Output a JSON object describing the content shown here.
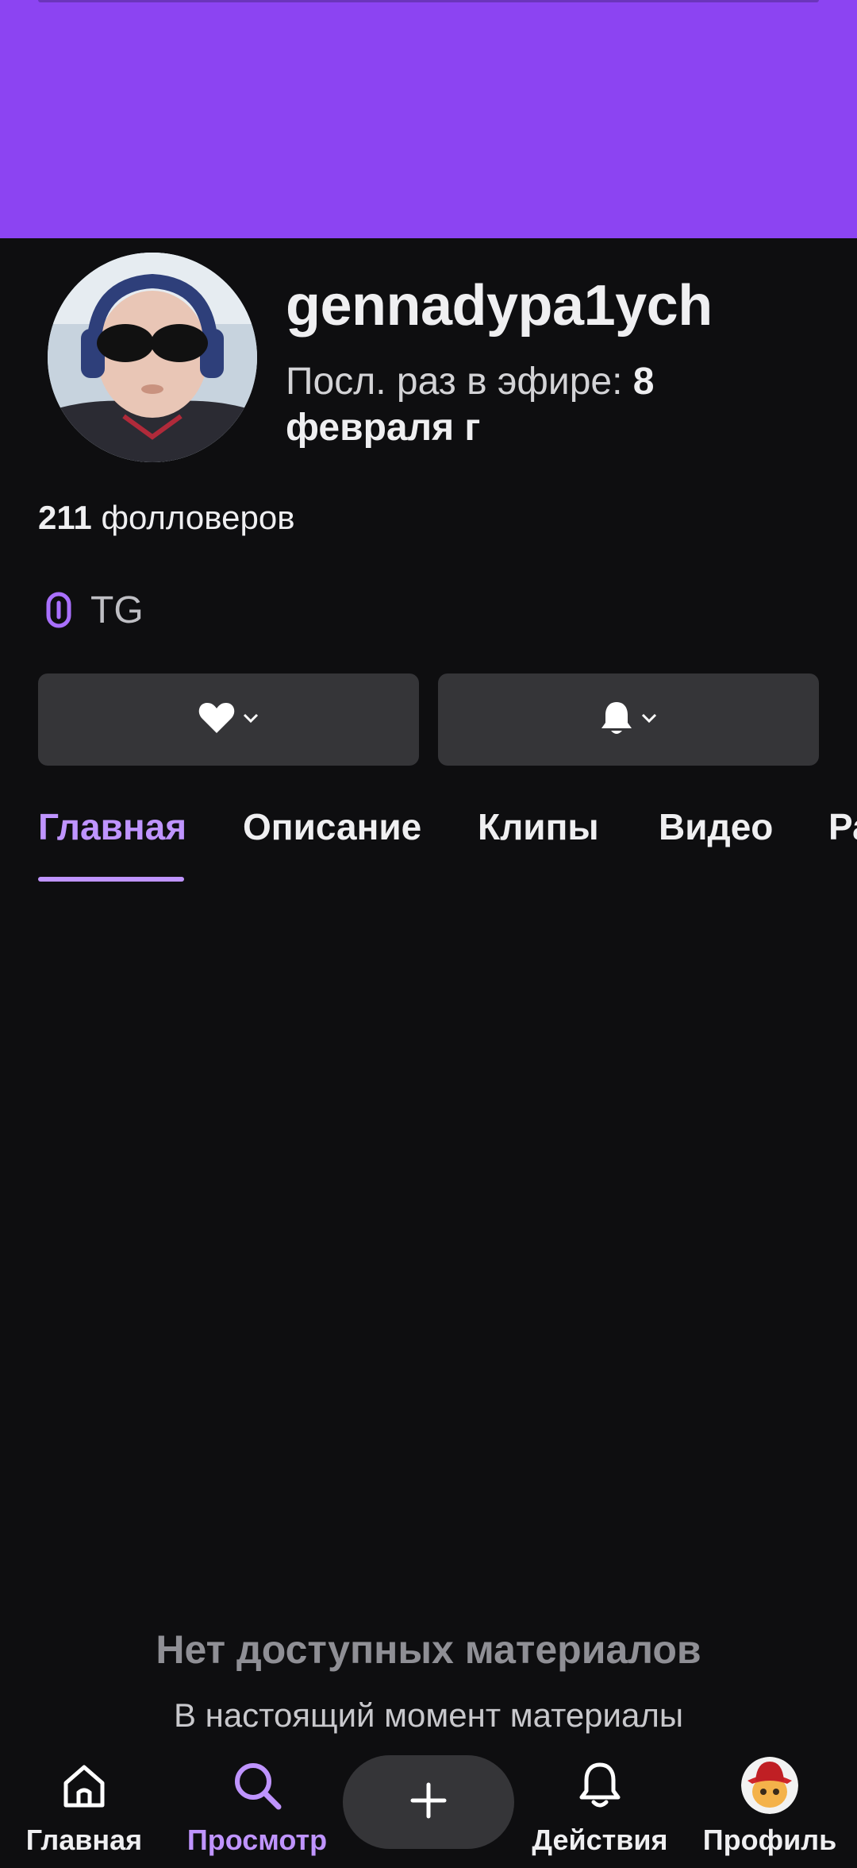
{
  "profile": {
    "username": "gennadypa1ych",
    "last_live_prefix": "Посл. раз в эфире:",
    "last_live_day": "8",
    "last_live_rest": "февраля  г",
    "followers_count": "211",
    "followers_label": "фолловеров"
  },
  "links": [
    {
      "icon": "link-icon",
      "label": "TG"
    }
  ],
  "actions": {
    "follow_icon": "heart-icon",
    "notify_icon": "bell-icon"
  },
  "tabs": [
    {
      "label": "Главная",
      "active": true
    },
    {
      "label": "Описание",
      "active": false
    },
    {
      "label": "Клипы",
      "active": false
    },
    {
      "label": "Видео",
      "active": false
    },
    {
      "label": "Ра",
      "active": false
    }
  ],
  "empty_state": {
    "title": "Нет доступных материалов",
    "subtitle": "В настоящий момент материалы"
  },
  "bottom_nav": [
    {
      "label": "Главная",
      "icon": "home-icon",
      "active": false
    },
    {
      "label": "Просмотр",
      "icon": "search-icon",
      "active": true
    },
    {
      "label": "",
      "icon": "plus-icon",
      "active": false
    },
    {
      "label": "Действия",
      "icon": "bell-icon",
      "active": false
    },
    {
      "label": "Профиль",
      "icon": "avatar",
      "active": false
    }
  ],
  "colors": {
    "banner": "#8c44f2",
    "accent": "#bf94ff",
    "background": "#0e0e10",
    "button": "#353538"
  }
}
